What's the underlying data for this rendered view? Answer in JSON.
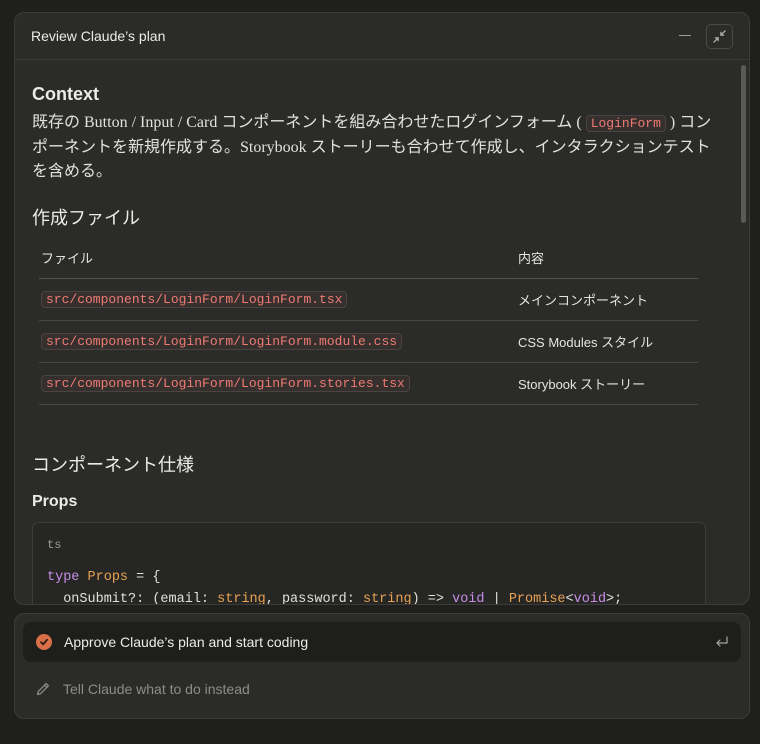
{
  "header": {
    "title": "Review Claude’s plan"
  },
  "context": {
    "heading": "Context",
    "text_1": "既存の Button / Input / Card コンポーネントを組み合わせたログインフォーム ( ",
    "code": "LoginForm",
    "text_2": " ) コンポーネントを新規作成する。Storybook ストーリーも合わせて作成し、インタラクションテストを含める。"
  },
  "files": {
    "heading": "作成ファイル",
    "columns": [
      "ファイル",
      "内容"
    ],
    "rows": [
      {
        "file": "src/components/LoginForm/LoginForm.tsx",
        "desc": "メインコンポーネント"
      },
      {
        "file": "src/components/LoginForm/LoginForm.module.css",
        "desc": "CSS Modules スタイル"
      },
      {
        "file": "src/components/LoginForm/LoginForm.stories.tsx",
        "desc": "Storybook ストーリー"
      }
    ]
  },
  "spec": {
    "heading": "コンポーネント仕様"
  },
  "props": {
    "heading": "Props",
    "lang": "ts",
    "line1": {
      "kw": "type",
      "ty": "Props",
      "rest": " = {"
    },
    "line2": {
      "a": "  onSubmit?: (email: ",
      "t1": "string",
      "b": ", password: ",
      "t2": "string",
      "c": ") => ",
      "k1": "void",
      "d": " | ",
      "t3": "Promise",
      "e": "<",
      "k2": "void",
      "f": ">;"
    }
  },
  "actions": {
    "approve": "Approve Claude’s plan and start coding",
    "instead_placeholder": "Tell Claude what to do instead"
  },
  "colors": {
    "accent": "#d96f46",
    "code_red": "#ef7a72",
    "keyword": "#c78fe8",
    "type": "#e9a253"
  }
}
